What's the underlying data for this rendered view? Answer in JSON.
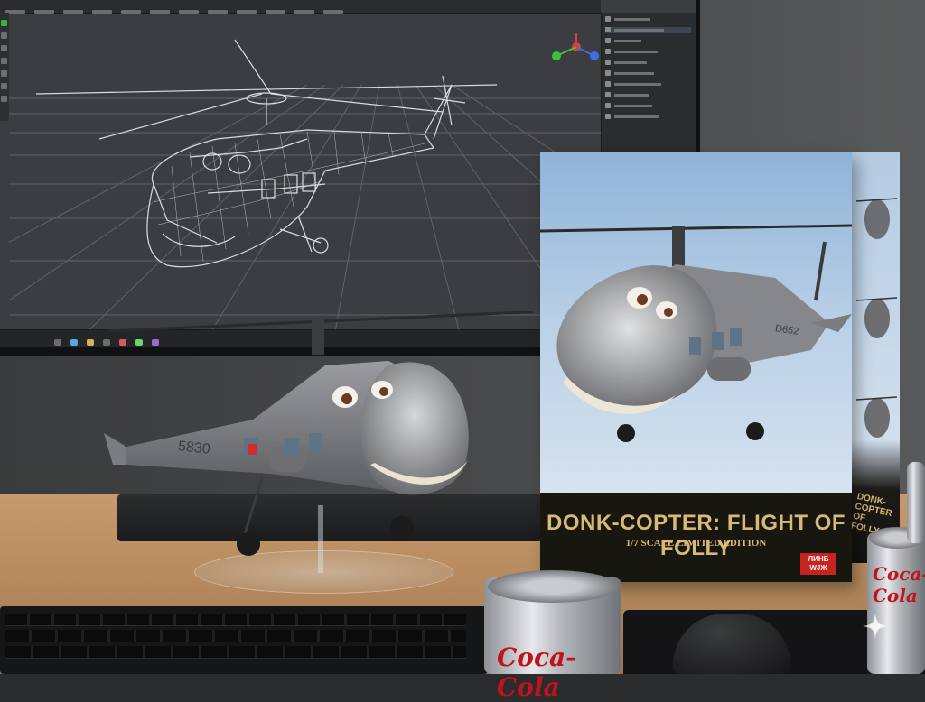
{
  "scene": {
    "description_hidden": "",
    "box": {
      "title": "DONK-COPTER: FLIGHT OF FOLLY",
      "subtitle": "1/7 SCALE LIMITED EDITION",
      "badge": "ЛИНБ\nWJЖ",
      "side_title": "DONK-COPTER OF FOLLY",
      "helicopter_number": "D652"
    },
    "model": {
      "fuselage_number": "5830"
    },
    "cans": {
      "logo": "Coca-Cola"
    },
    "colors": {
      "box_gold": "#d8b978",
      "box_band": "#17160f",
      "sky": "#b9d0e6",
      "desk": "#b78b5f",
      "screen_bg": "#3b3d40",
      "can_red": "#c0141c",
      "badge_red": "#c8241f"
    },
    "icons": {
      "sparkle": "sparkle-icon",
      "navigation_gizmo": "axis-gizmo-icon"
    }
  }
}
